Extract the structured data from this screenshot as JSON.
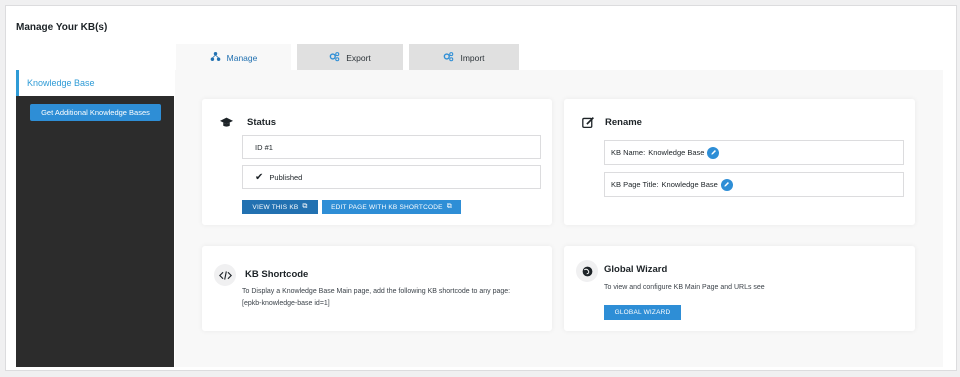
{
  "page": {
    "title": "Manage Your KB(s)"
  },
  "tabs": [
    {
      "label": "Manage",
      "icon": "kb-structure-icon",
      "active": true
    },
    {
      "label": "Export",
      "icon": "gears-icon",
      "active": false
    },
    {
      "label": "Import",
      "icon": "gears-icon",
      "active": false
    }
  ],
  "sidebar": {
    "kb_item": "Knowledge Base",
    "add_button": "Get Additional Knowledge Bases"
  },
  "status": {
    "title": "Status",
    "id": "ID #1",
    "state": "Published",
    "view_button": "VIEW THIS KB",
    "edit_button": "EDIT PAGE WITH KB SHORTCODE"
  },
  "rename": {
    "title": "Rename",
    "kb_name_label": "KB Name:",
    "kb_name_value": "Knowledge Base",
    "kb_page_title_label": "KB Page Title:",
    "kb_page_title_value": "Knowledge Base"
  },
  "shortcode": {
    "title": "KB Shortcode",
    "description": "To Display a Knowledge Base Main page, add the following KB shortcode to any page:",
    "code": "[epkb-knowledge-base id=1]"
  },
  "wizard": {
    "title": "Global Wizard",
    "description": "To view and configure KB Main Page and URLs see",
    "button": "GLOBAL WIZARD"
  },
  "colors": {
    "accent": "#2271b1",
    "accent_light": "#2e8ed6",
    "sidebar": "#2c2c2c"
  }
}
